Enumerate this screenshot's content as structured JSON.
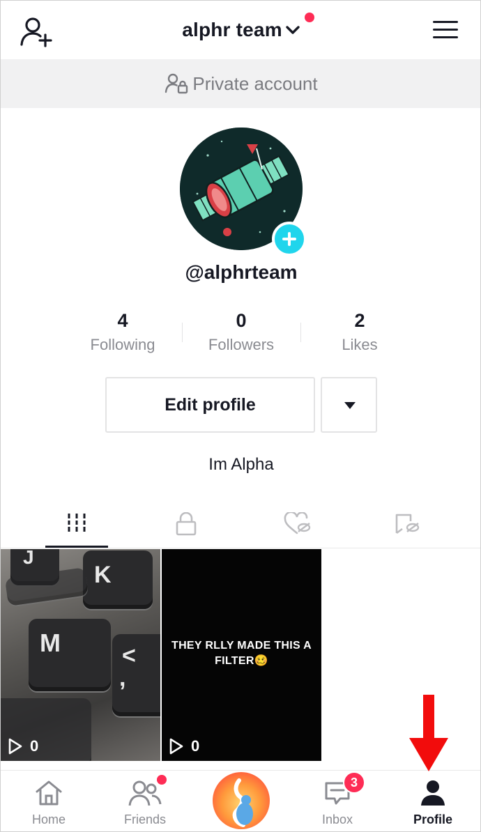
{
  "header": {
    "title": "alphr team"
  },
  "private_bar": {
    "label": "Private account"
  },
  "profile": {
    "username": "@alphrteam",
    "bio": "Im Alpha"
  },
  "stats": [
    {
      "value": "4",
      "label": "Following"
    },
    {
      "value": "0",
      "label": "Followers"
    },
    {
      "value": "2",
      "label": "Likes"
    }
  ],
  "actions": {
    "edit_profile": "Edit profile"
  },
  "tabs": [
    "videos-grid-icon",
    "lock-icon",
    "liked-hidden-icon",
    "saved-hidden-icon"
  ],
  "videos": [
    {
      "views": "0",
      "overlay_text": "",
      "key_labels": [
        "J",
        "K",
        "M",
        "<",
        ","
      ]
    },
    {
      "views": "0",
      "overlay_text": "THEY RLLY MADE THIS A FILTER🥴"
    }
  ],
  "bottom_nav": {
    "items": [
      {
        "label": "Home"
      },
      {
        "label": "Friends"
      },
      {
        "label": "Inbox"
      },
      {
        "label": "Profile"
      }
    ],
    "inbox_badge": "3"
  },
  "colors": {
    "accent_red": "#fe2c55",
    "accent_cyan": "#20d5ec",
    "text": "#161823",
    "secondary_text": "#8a8b91"
  }
}
